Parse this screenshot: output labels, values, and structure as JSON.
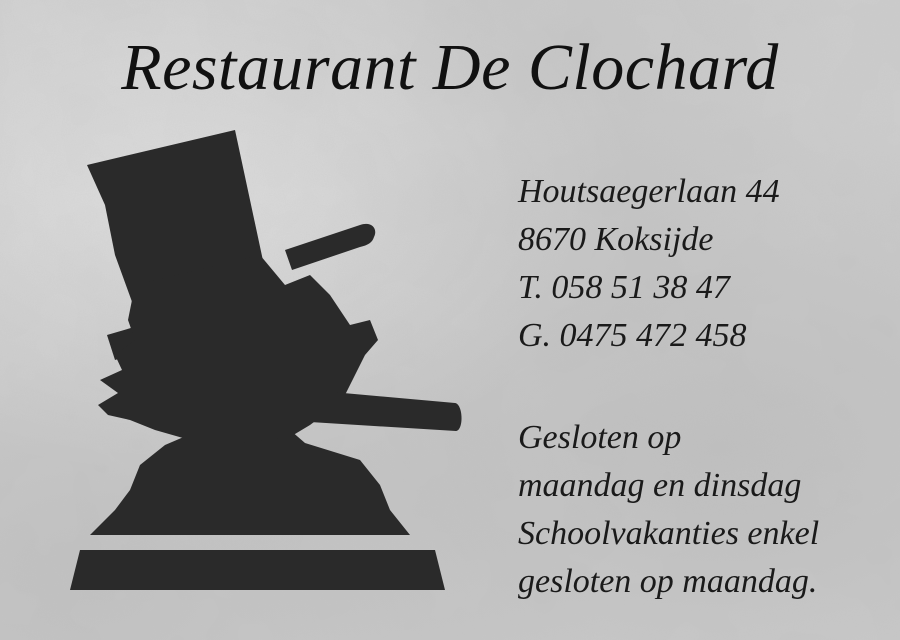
{
  "card": {
    "title": "Restaurant De Clochard",
    "address": {
      "street": "Houtsaegerlaan 44",
      "city": "8670 Koksijde",
      "phone": "T. 058 51 38 47",
      "mobile": "G. 0475 472 458"
    },
    "hours": {
      "line1": "Gesloten op",
      "line2": "maandag en dinsdag",
      "line3": "Schoolvakanties enkel",
      "line4": "gesloten op maandag."
    }
  },
  "colors": {
    "background": "#cfcfcf",
    "ink": "#1a1a1a",
    "silhouette": "#2a2a2a"
  },
  "icons": {
    "logo": "clochard-silhouette-icon"
  }
}
